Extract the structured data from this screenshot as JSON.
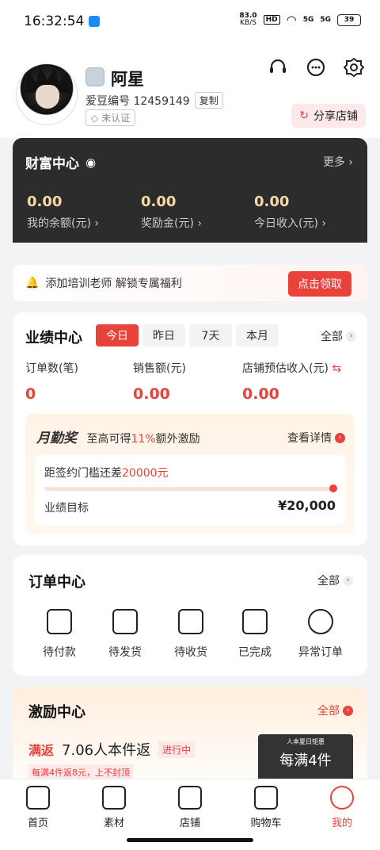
{
  "status": {
    "time": "16:32:54",
    "speed": "83.0",
    "speed_unit": "KB/S",
    "battery": "39",
    "net1": "5G",
    "net2": "5G",
    "hd": "HD"
  },
  "profile": {
    "name": "阿星",
    "id_label": "爱豆编号 12459149",
    "copy": "复制",
    "verify": "未认证",
    "share": "分享店铺"
  },
  "wealth": {
    "title": "财富中心",
    "more": "更多",
    "items": [
      {
        "value": "0.00",
        "label": "我的余额(元)"
      },
      {
        "value": "0.00",
        "label": "奖励金(元)"
      },
      {
        "value": "0.00",
        "label": "今日收入(元)"
      }
    ]
  },
  "promo": {
    "text": "添加培训老师 解锁专属福利",
    "button": "点击领取"
  },
  "perf": {
    "title": "业绩中心",
    "tabs": [
      "今日",
      "昨日",
      "7天",
      "本月"
    ],
    "all": "全部",
    "metrics": [
      {
        "label": "订单数(笔)",
        "value": "0"
      },
      {
        "label": "销售额(元)",
        "value": "0.00"
      },
      {
        "label": "店铺预估收入(元)",
        "value": "0.00"
      }
    ],
    "month": {
      "title": "月勤奖",
      "desc_pre": "至高可得",
      "pct": "11%",
      "desc_post": "额外激励",
      "detail": "查看详情",
      "gap_pre": "距签约门槛还差",
      "gap_val": "20000元",
      "target_label": "业绩目标",
      "target_value": "¥20,000",
      "progress": 1.0
    }
  },
  "orders": {
    "title": "订单中心",
    "all": "全部",
    "items": [
      "待付款",
      "待发货",
      "待收货",
      "已完成",
      "异常订单"
    ]
  },
  "incent": {
    "title": "激励中心",
    "all": "全部",
    "tag": "满返",
    "name": "7.06人本件返",
    "status": "进行中",
    "note": "每满4件返8元，上不封顶",
    "banner_top": "人本夏日钜惠",
    "banner_main": "每满4件"
  },
  "nav": {
    "items": [
      "首页",
      "素材",
      "店铺",
      "购物车",
      "我的"
    ],
    "active": 4
  },
  "colors": {
    "accent": "#e8423b",
    "gold": "#f5d9a4"
  }
}
